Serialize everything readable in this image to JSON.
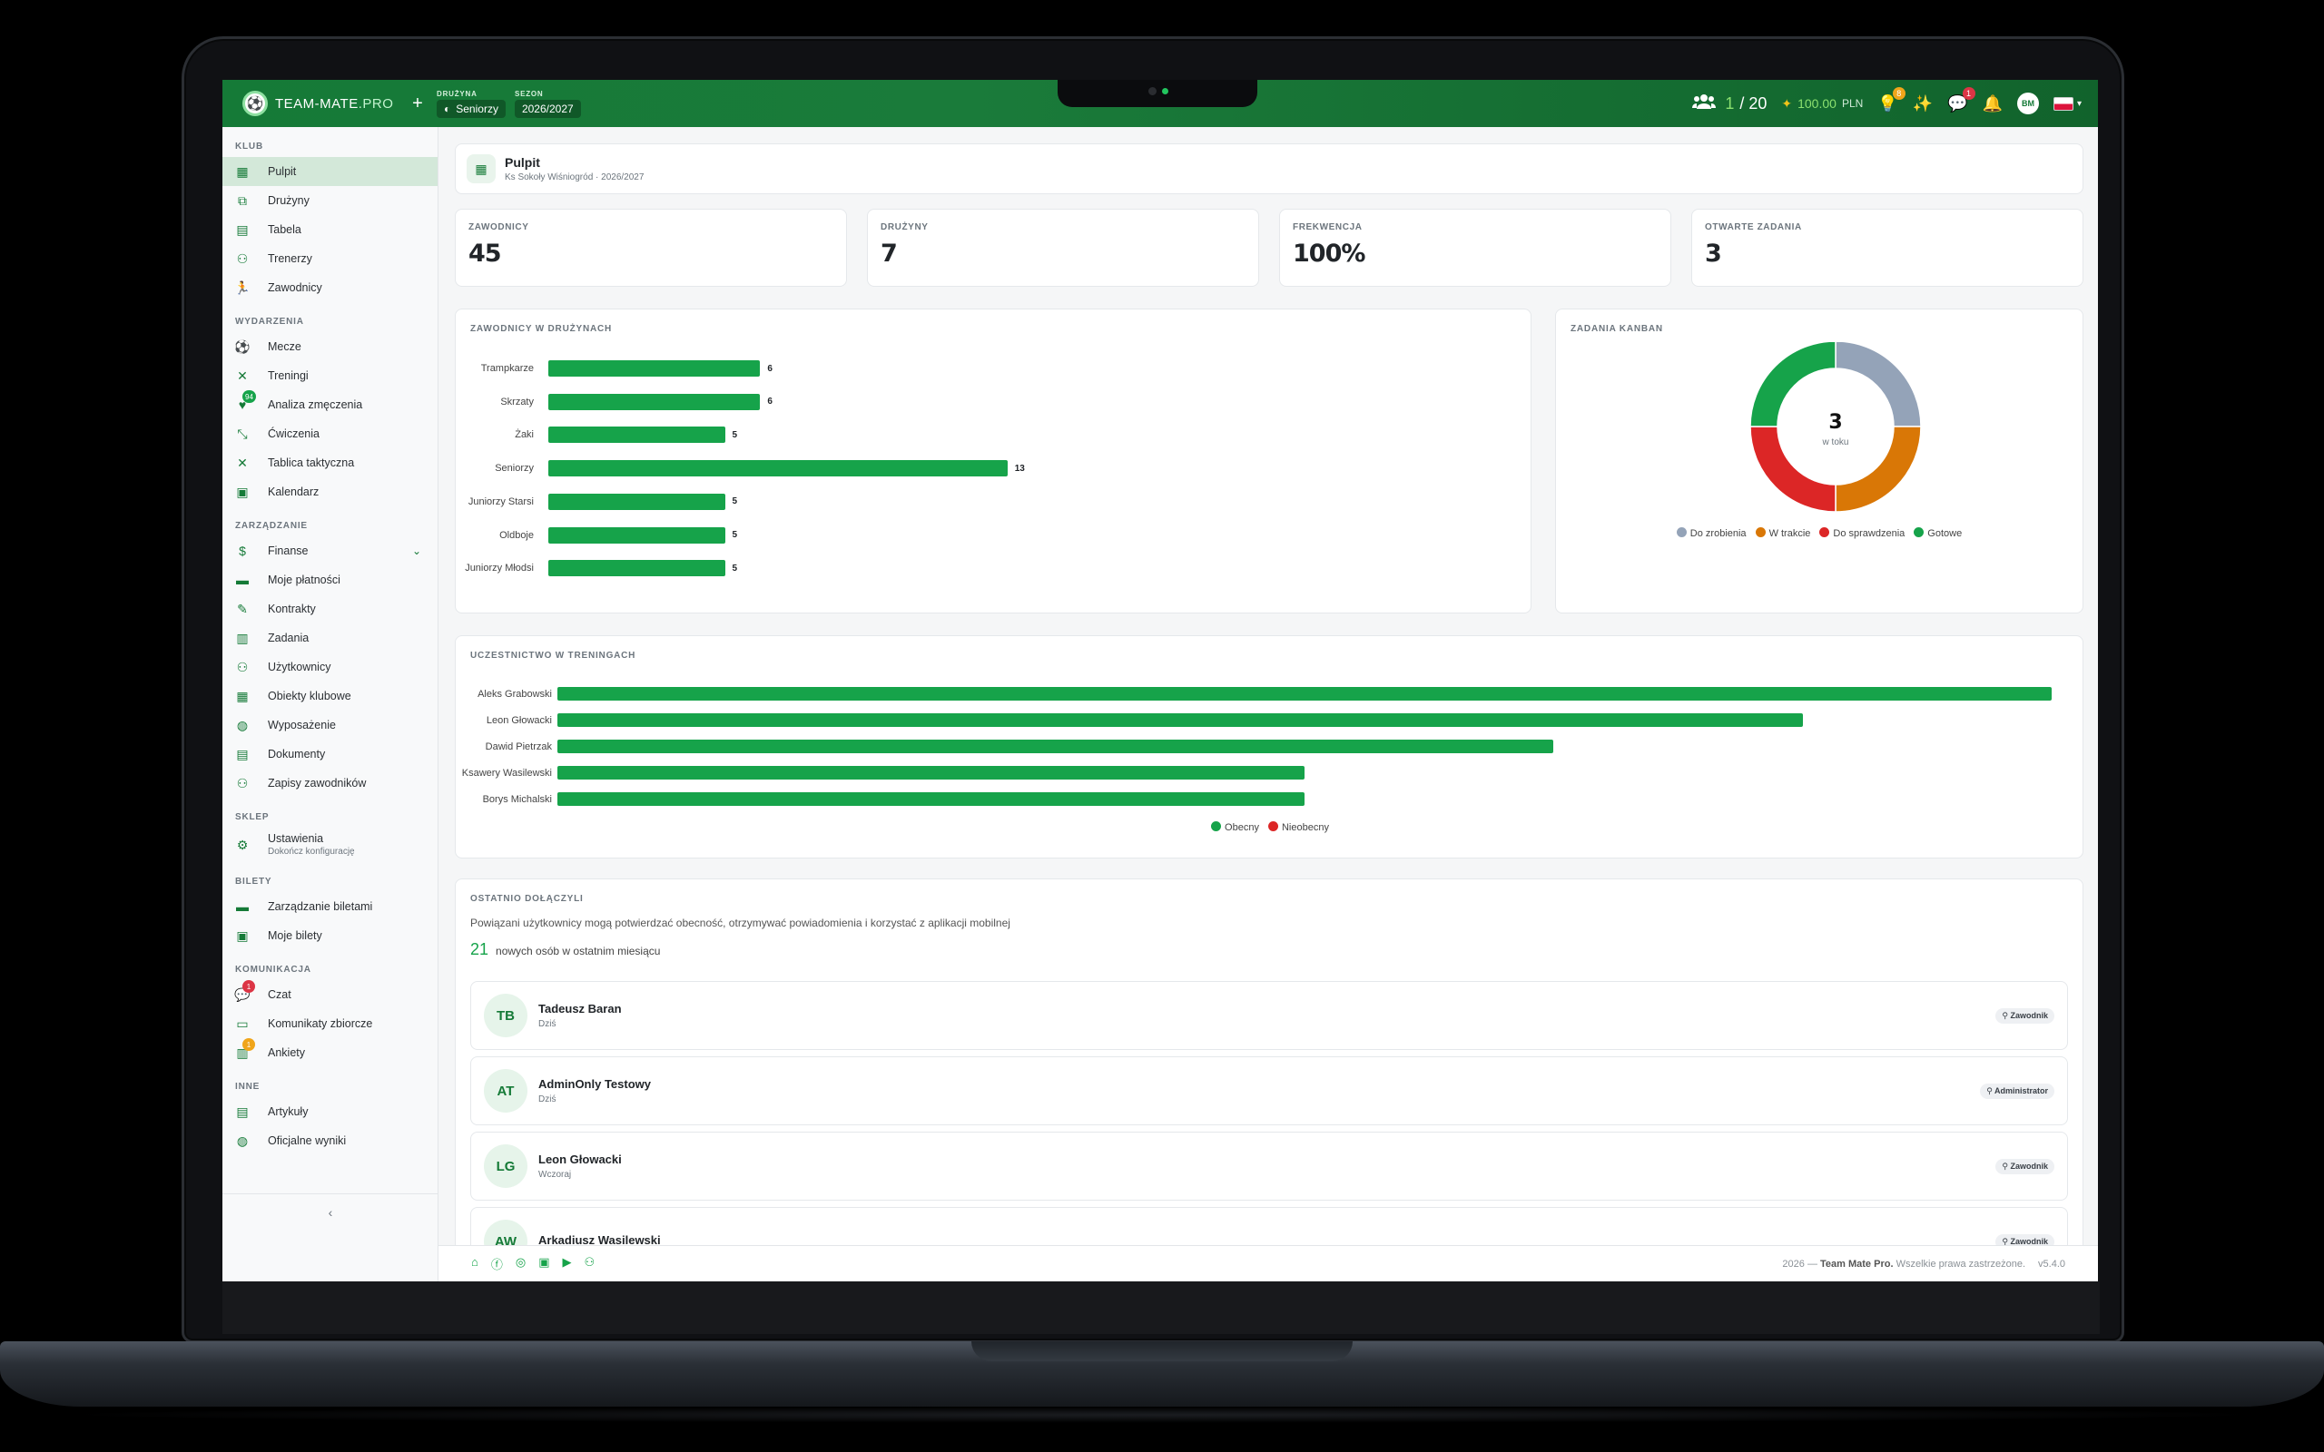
{
  "topbar": {
    "logo_main": "TEAM-MATE",
    "logo_suffix": ".PRO",
    "team_label": "DRUŻYNA",
    "team_value": "Seniorzy",
    "season_label": "SEZON",
    "season_value": "2026/2027",
    "members": "1",
    "members_total": "/ 20",
    "wallet_amount": "100.00",
    "wallet_currency": "PLN",
    "ideas_badge": "8",
    "chat_badge": "1",
    "user_initials": "BM"
  },
  "sidebar": {
    "sections": {
      "klub": "KLUB",
      "wydarzenia": "WYDARZENIA",
      "zarzadzanie": "ZARZĄDZANIE",
      "sklep": "SKLEP",
      "bilety": "BILETY",
      "komunikacja": "KOMUNIKACJA",
      "inne": "INNE"
    },
    "items": {
      "pulpit": "Pulpit",
      "druzyny": "Drużyny",
      "tabela": "Tabela",
      "trenerzy": "Trenerzy",
      "zawodnicy": "Zawodnicy",
      "mecze": "Mecze",
      "treningi": "Treningi",
      "analiza": "Analiza zmęczenia",
      "analiza_badge": "94",
      "cwiczenia": "Ćwiczenia",
      "tablica": "Tablica taktyczna",
      "kalendarz": "Kalendarz",
      "finanse": "Finanse",
      "platnosci": "Moje płatności",
      "kontrakty": "Kontrakty",
      "zadania": "Zadania",
      "uzytkownicy": "Użytkownicy",
      "obiekty": "Obiekty klubowe",
      "wyposazenie": "Wyposażenie",
      "dokumenty": "Dokumenty",
      "zapisy": "Zapisy zawodników",
      "ustawienia": "Ustawienia",
      "ustawienia_sub": "Dokończ konfigurację",
      "bilety_zarz": "Zarządzanie biletami",
      "moje_bilety": "Moje bilety",
      "czat": "Czat",
      "czat_badge": "1",
      "komunikaty": "Komunikaty zbiorcze",
      "ankiety": "Ankiety",
      "ankiety_badge": "1",
      "artykuly": "Artykuły",
      "wyniki": "Oficjalne wyniki"
    }
  },
  "header": {
    "title": "Pulpit",
    "subtitle": "Ks Sokoły Wiśniogród · 2026/2027"
  },
  "stats": [
    {
      "label": "ZAWODNICY",
      "value": "45"
    },
    {
      "label": "DRUŻYNY",
      "value": "7"
    },
    {
      "label": "FREKWENCJA",
      "value": "100%"
    },
    {
      "label": "OTWARTE ZADANIA",
      "value": "3"
    }
  ],
  "chart_data": [
    {
      "type": "bar",
      "orientation": "horizontal",
      "title": "ZAWODNICY W DRUŻYNACH",
      "categories": [
        "Trampkarze",
        "Skrzaty",
        "Żaki",
        "Seniorzy",
        "Juniorzy Starsi",
        "Oldboje",
        "Juniorzy Młodsi"
      ],
      "values": [
        6,
        6,
        5,
        13,
        5,
        5,
        5
      ],
      "data_labels": [
        "6",
        "6",
        "5",
        "13",
        "5",
        "5",
        "5"
      ],
      "color": "#16a34a"
    },
    {
      "type": "pie",
      "variant": "donut",
      "title": "ZADANIA KANBAN",
      "center_value": "3",
      "center_label": "w toku",
      "categories": [
        "Do zrobienia",
        "W trakcie",
        "Do sprawdzenia",
        "Gotowe"
      ],
      "values": [
        1,
        1,
        1,
        1
      ],
      "colors": [
        "#94a3b8",
        "#d97706",
        "#dc2626",
        "#16a34a"
      ],
      "legend": "bottom"
    },
    {
      "type": "bar",
      "orientation": "horizontal",
      "stacked": true,
      "title": "UCZESTNICTWO W TRENINGACH",
      "categories": [
        "Aleks Grabowski",
        "Leon Głowacki",
        "Dawid Pietrzak",
        "Ksawery Wasilewski",
        "Borys Michalski"
      ],
      "series": [
        {
          "name": "Obecny",
          "values": [
            6,
            5,
            4,
            3,
            3
          ],
          "color": "#16a34a"
        },
        {
          "name": "Nieobecny",
          "values": [
            0,
            0,
            0,
            0,
            0
          ],
          "color": "#dc2626"
        }
      ],
      "xlim": [
        0,
        6
      ],
      "legend": "bottom"
    }
  ],
  "recent": {
    "title": "OSTATNIO DOŁĄCZYLI",
    "description": "Powiązani użytkownicy mogą potwierdzać obecność, otrzymywać powiadomienia i korzystać z aplikacji mobilnej",
    "count": "21",
    "count_text": "nowych osób w ostatnim miesiącu",
    "people": [
      {
        "initials": "TB",
        "name": "Tadeusz Baran",
        "when": "Dziś",
        "role": "Zawodnik"
      },
      {
        "initials": "AT",
        "name": "AdminOnly Testowy",
        "when": "Dziś",
        "role": "Administrator"
      },
      {
        "initials": "LG",
        "name": "Leon Głowacki",
        "when": "Wczoraj",
        "role": "Zawodnik"
      },
      {
        "initials": "AW",
        "name": "Arkadiusz Wasilewski",
        "when": "",
        "role": "Zawodnik"
      }
    ]
  },
  "footer": {
    "year": "2026 —",
    "brand": "Team Mate Pro.",
    "rights": "Wszelkie prawa zastrzeżone.",
    "version": "v5.4.0"
  }
}
